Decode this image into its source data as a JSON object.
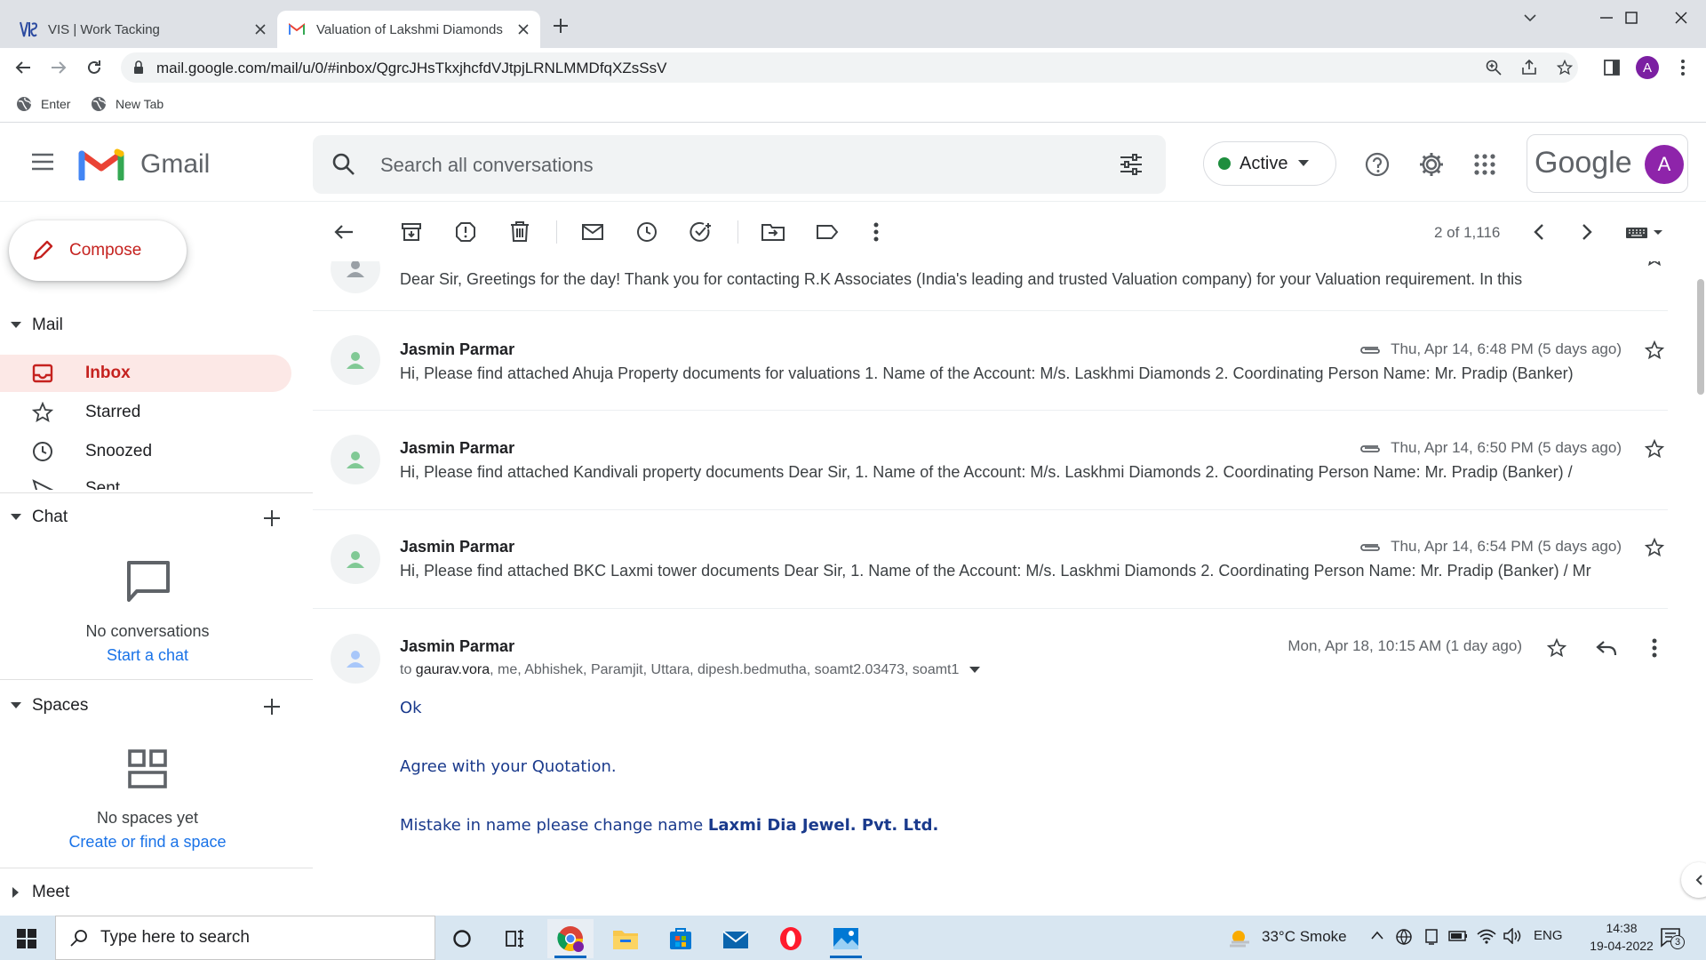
{
  "browser": {
    "tabs": [
      {
        "title": "VIS | Work Tacking",
        "favicon": "vis-logo-icon"
      },
      {
        "title": "Valuation of Lakshmi Diamonds",
        "favicon": "gmail-icon"
      }
    ],
    "url": "mail.google.com/mail/u/0/#inbox/QgrcJHsTkxjhcfdVJtpjLRNLMMDfqXZsSsV",
    "profile_initial": "A",
    "bookmarks": [
      {
        "label": "Enter",
        "icon": "globe-icon"
      },
      {
        "label": "New Tab",
        "icon": "globe-icon"
      }
    ]
  },
  "gmail": {
    "brand": "Gmail",
    "search_placeholder": "Search all conversations",
    "status": "Active",
    "google_label": "Google",
    "account_initial": "A",
    "compose_label": "Compose",
    "sections": {
      "mail": "Mail",
      "chat": "Chat",
      "spaces": "Spaces",
      "meet": "Meet"
    },
    "nav": [
      {
        "label": "Inbox",
        "icon": "inbox-icon",
        "selected": true
      },
      {
        "label": "Starred",
        "icon": "star-icon",
        "selected": false
      },
      {
        "label": "Snoozed",
        "icon": "clock-icon",
        "selected": false
      },
      {
        "label": "Sent",
        "icon": "send-icon",
        "selected": false
      }
    ],
    "chat_empty": {
      "text": "No conversations",
      "link": "Start a chat"
    },
    "spaces_empty": {
      "text": "No spaces yet",
      "link": "Create or find a space"
    },
    "pager": "2 of 1,116"
  },
  "thread": {
    "partial_snippet": "Dear Sir, Greetings for the day! Thank you for contacting R.K Associates (India's leading and trusted Valuation company) for your Valuation requirement. In this",
    "messages": [
      {
        "sender": "Jasmin Parmar",
        "date": "Thu, Apr 14, 6:48 PM (5 days ago)",
        "snippet": "Hi, Please find attached Ahuja Property documents for valuations 1. Name of the Account: M/s. Laskhmi Diamonds 2. Coordinating Person Name: Mr. Pradip (Banker)"
      },
      {
        "sender": "Jasmin Parmar",
        "date": "Thu, Apr 14, 6:50 PM (5 days ago)",
        "snippet": "Hi, Please find attached Kandivali property documents Dear Sir, 1. Name of the Account: M/s. Laskhmi Diamonds 2. Coordinating Person Name: Mr. Pradip (Banker) /"
      },
      {
        "sender": "Jasmin Parmar",
        "date": "Thu, Apr 14, 6:54 PM (5 days ago)",
        "snippet": "Hi, Please find attached BKC Laxmi tower documents Dear Sir, 1. Name of the Account: M/s. Laskhmi Diamonds 2. Coordinating Person Name: Mr. Pradip (Banker) / Mr"
      }
    ],
    "open_message": {
      "sender": "Jasmin Parmar",
      "date": "Mon, Apr 18, 10:15 AM (1 day ago)",
      "to_prefix": "to",
      "to_first": "gaurav.vora",
      "to_rest": ", me, Abhishek, Paramjit, Uttara, dipesh.bedmutha, soamt2.03473, soamt1",
      "body": {
        "line1": "Ok",
        "line2": "Agree with your Quotation.",
        "line3_prefix": "Mistake in name please change name ",
        "line3_bold": "Laxmi Dia Jewel. Pvt. Ltd."
      }
    }
  },
  "taskbar": {
    "search_placeholder": "Type here to search",
    "weather": "33°C  Smoke",
    "language": "ENG",
    "time": "14:38",
    "date": "19-04-2022",
    "notifications": "3"
  },
  "colors": {
    "gmail_red": "#c5221f",
    "selected_nav_bg": "#fce8e6",
    "link_blue": "#1a73e8",
    "status_green": "#1e8e3e",
    "body_text_blue": "#1a3a8c"
  }
}
